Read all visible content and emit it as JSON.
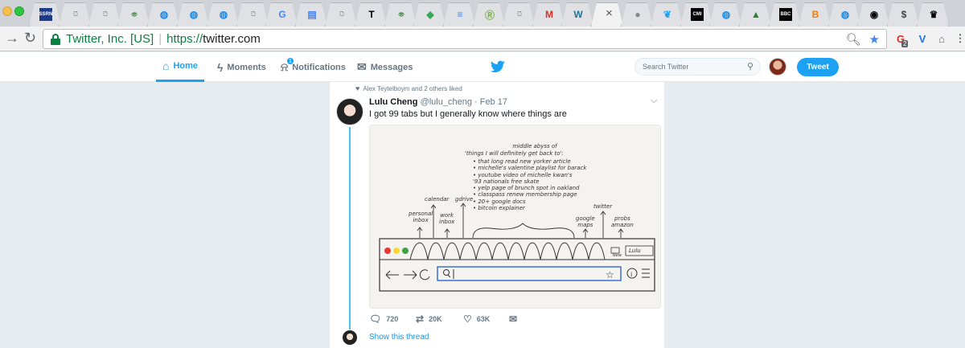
{
  "browser": {
    "tabs": [
      {
        "icon": "ssrn-icon",
        "glyph": "SSRN"
      },
      {
        "icon": "page-icon",
        "glyph": "🗋"
      },
      {
        "icon": "page-icon",
        "glyph": "🗋"
      },
      {
        "icon": "eye-icon",
        "glyph": "👁"
      },
      {
        "icon": "globe-icon",
        "glyph": "◍"
      },
      {
        "icon": "globe-icon",
        "glyph": "◍"
      },
      {
        "icon": "globe-icon",
        "glyph": "◍"
      },
      {
        "icon": "page-icon",
        "glyph": "🗋"
      },
      {
        "icon": "google-icon",
        "glyph": "G"
      },
      {
        "icon": "doc-icon",
        "glyph": "▤"
      },
      {
        "icon": "page-icon",
        "glyph": "🗋"
      },
      {
        "icon": "nyt-icon",
        "glyph": "T"
      },
      {
        "icon": "eye-icon",
        "glyph": "👁"
      },
      {
        "icon": "maps-icon",
        "glyph": "◆"
      },
      {
        "icon": "docs-icon",
        "glyph": "≡"
      },
      {
        "icon": "circle-r-icon",
        "glyph": "Ⓡ"
      },
      {
        "icon": "page-icon",
        "glyph": "🗋"
      },
      {
        "icon": "gmail-icon",
        "glyph": "M"
      },
      {
        "icon": "wordpress-icon",
        "glyph": "W"
      },
      {
        "icon": "close-icon",
        "glyph": "×",
        "active": true
      },
      {
        "icon": "sphere-icon",
        "glyph": "●"
      },
      {
        "icon": "twitter-bird-icon",
        "glyph": "❦"
      },
      {
        "icon": "cmi-icon",
        "glyph": "CMI"
      },
      {
        "icon": "globe-icon",
        "glyph": "◍"
      },
      {
        "icon": "africa-icon",
        "glyph": "▲"
      },
      {
        "icon": "bbc-icon",
        "glyph": "BBC"
      },
      {
        "icon": "blogger-icon",
        "glyph": "B"
      },
      {
        "icon": "globe-icon",
        "glyph": "◍"
      },
      {
        "icon": "dark-circle-icon",
        "glyph": "◉"
      },
      {
        "icon": "coin-icon",
        "glyph": "$"
      },
      {
        "icon": "crown-icon",
        "glyph": "♛"
      }
    ],
    "ev_cert": "Twitter, Inc. [US]",
    "url_scheme": "https://",
    "url_host": "twitter.com",
    "extension_badge": "2"
  },
  "twitter": {
    "nav": {
      "home": "Home",
      "moments": "Moments",
      "notifications": "Notifications",
      "notifications_count": "1",
      "messages": "Messages"
    },
    "search_placeholder": "Search Twitter",
    "tweet_button": "Tweet",
    "brand_color": "#1da1f2"
  },
  "tweet": {
    "social_context": "Alex Teytelboym and 2 others liked",
    "author_name": "Lulu Cheng",
    "author_handle": "@lulu_cheng",
    "dot": "·",
    "date": "Feb 17",
    "text": "I got 99 tabs but I generally know where things are",
    "actions": {
      "replies": "720",
      "retweets": "20K",
      "likes": "63K"
    },
    "show_thread": "Show this thread"
  },
  "sketch": {
    "heading": [
      "middle abyss of",
      "'things I will definitely get back to':"
    ],
    "items": [
      "• that long read new yorker article",
      "• michelle's valentine playlist for barack",
      "• youtube video of michelle kwan's",
      "  '93 nationals free skate",
      "• yelp page of brunch spot in oakland",
      "• classpass renew membership page",
      "• 20+ google docs",
      "• bitcoin explainer"
    ],
    "labels": {
      "calendar": "calendar",
      "gdrive": "gdrive",
      "personal_inbox": [
        "personal",
        "inbox"
      ],
      "work_inbox": [
        "work",
        "inbox"
      ],
      "google_maps": [
        "google",
        "maps"
      ],
      "twitter": "twitter",
      "probs_amazon": [
        "probs",
        "amazon"
      ],
      "new": "New",
      "profile": "Lulu"
    }
  }
}
